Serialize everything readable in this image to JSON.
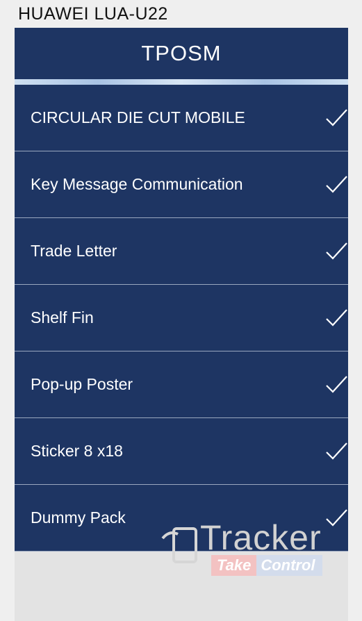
{
  "device_label": "HUAWEI LUA-U22",
  "header": {
    "title": "TPOSM"
  },
  "items": [
    {
      "label": "CIRCULAR DIE CUT MOBILE",
      "checked": true
    },
    {
      "label": "Key Message Communication",
      "checked": true
    },
    {
      "label": "Trade Letter",
      "checked": true
    },
    {
      "label": "Shelf Fin",
      "checked": true
    },
    {
      "label": "Pop-up Poster",
      "checked": true
    },
    {
      "label": "Sticker 8 x18",
      "checked": true
    },
    {
      "label": "Dummy Pack",
      "checked": true
    }
  ],
  "watermark": {
    "brand": "Tracker",
    "take": "Take",
    "control": "Control"
  },
  "colors": {
    "header_bg": "#1e3563",
    "list_bg": "#1e3563",
    "divider": "#9aa8bf",
    "check": "#ffffff"
  }
}
